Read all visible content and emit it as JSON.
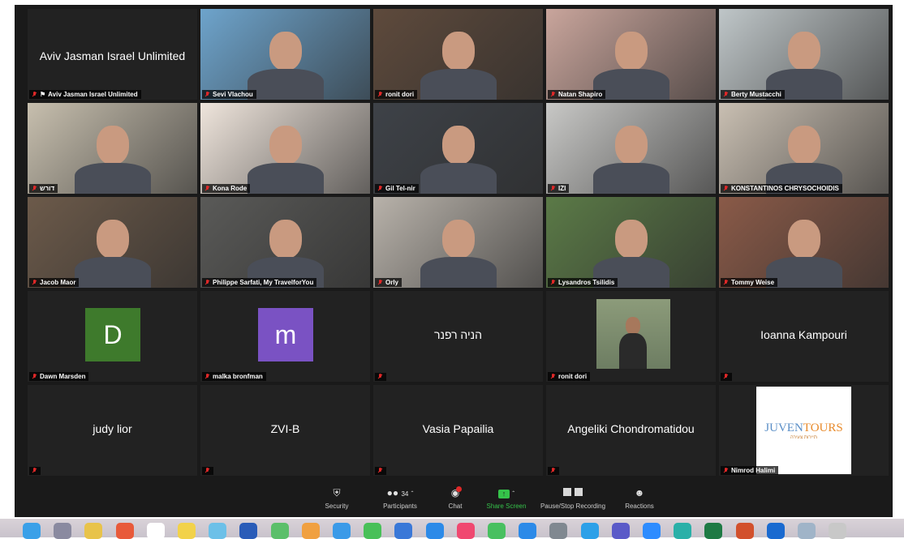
{
  "tiles": [
    {
      "name": "Aviv Jasman Israel Unlimited",
      "type": "text",
      "center": "Aviv Jasman Israel Unlimited",
      "pin": true
    },
    {
      "name": "Sevi Vlachou",
      "type": "video",
      "bg": "#6ea4cc"
    },
    {
      "name": "ronit dori",
      "type": "video",
      "bg": "#5e4a3c"
    },
    {
      "name": "Natan Shapiro",
      "type": "video",
      "bg": "#c9a59c"
    },
    {
      "name": "Berty Mustacchi",
      "type": "video",
      "bg": "#bfc6c8"
    },
    {
      "name": "דורש",
      "type": "video",
      "bg": "#c7bfae"
    },
    {
      "name": "Kona Rode",
      "type": "video",
      "bg": "#efe5dc"
    },
    {
      "name": "Gil Tel-nir",
      "type": "video",
      "bg": "#3e4248"
    },
    {
      "name": "IZI",
      "type": "video",
      "bg": "#c8c8c6",
      "highlight": true
    },
    {
      "name": "KONSTANTINOS CHRYSOCHOIDIS",
      "type": "video",
      "bg": "#c9bfb2"
    },
    {
      "name": "Jacob Maor",
      "type": "video",
      "bg": "#6c5a4a"
    },
    {
      "name": "Philippe Sarfati, My TravelforYou",
      "type": "video",
      "bg": "#5a5a58"
    },
    {
      "name": "Orly",
      "type": "video",
      "bg": "#b8b2aa"
    },
    {
      "name": "Lysandros Tsilidis",
      "type": "video",
      "bg": "#5b7a47"
    },
    {
      "name": "Tommy Weise",
      "type": "video",
      "bg": "#8a5a48"
    },
    {
      "name": "Dawn Marsden",
      "type": "avatar",
      "initial": "D",
      "color": "#3e7a2c"
    },
    {
      "name": "malka bronfman",
      "type": "avatar",
      "initial": "m",
      "color": "#7a52c3"
    },
    {
      "name": "",
      "type": "text",
      "center": "הניה רפנר"
    },
    {
      "name": "ronit dori",
      "type": "photo",
      "bg": "#6d7d62"
    },
    {
      "name": "",
      "type": "text",
      "center": "Ioanna Kampouri"
    },
    {
      "name": "",
      "type": "text",
      "center": "judy lior"
    },
    {
      "name": "",
      "type": "text",
      "center": "ZVI-B"
    },
    {
      "name": "",
      "type": "text",
      "center": "Vasia Papailia"
    },
    {
      "name": "",
      "type": "text",
      "center": "Angeliki Chondromatidou"
    },
    {
      "name": "Nimrod Halimi",
      "type": "logo",
      "logo_text_1": "JUVEN",
      "logo_text_2": "TOURS",
      "logo_sub": "תיירות צעירה"
    }
  ],
  "toolbar": {
    "security": "Security",
    "participants": "Participants",
    "participants_count": "34",
    "chat": "Chat",
    "share_screen": "Share Screen",
    "record": "Pause/Stop Recording",
    "reactions": "Reactions"
  },
  "colors": {
    "active_border": "#b8d83a",
    "share_green": "#35c24a",
    "muted_red": "#e02828"
  },
  "dock_icons": [
    "finder-icon",
    "launchpad-icon",
    "notes-icon",
    "chrome-icon",
    "calendar-icon",
    "stickies-icon",
    "preview-icon",
    "word-icon",
    "maps-icon",
    "photos-icon",
    "safari-icon",
    "facetime-icon",
    "keynote-icon",
    "appstore-icon",
    "music-icon",
    "messages-icon",
    "appstore2-icon",
    "settings-icon",
    "skype-icon",
    "teams-icon",
    "zoom-icon",
    "edge-icon",
    "excel-icon",
    "powerpoint-icon",
    "outlook-icon",
    "folder-icon",
    "trash-icon"
  ]
}
